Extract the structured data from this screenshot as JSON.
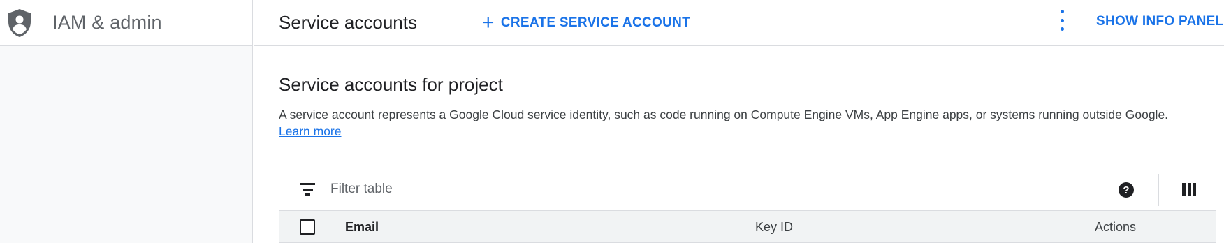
{
  "nav": {
    "title": "IAM & admin",
    "icon": "shield-person-icon"
  },
  "topbar": {
    "page_title": "Service accounts",
    "create_label": "CREATE SERVICE ACCOUNT",
    "create_icon": "+",
    "info_label": "SHOW INFO PANEL",
    "more_icon": "more-vert-icon"
  },
  "content": {
    "section_title": "Service accounts for project",
    "description": "A service account represents a Google Cloud service identity, such as code running on Compute Engine VMs, App Engine apps, or systems running outside Google.",
    "learn_more": "Learn more"
  },
  "table": {
    "filter_placeholder": "Filter table",
    "help_glyph": "?",
    "columns": [
      "Email",
      "Key ID",
      "Actions"
    ]
  },
  "colors": {
    "accent": "#1a73e8",
    "nav_bg": "#f8f9fa",
    "header_bg": "#f1f3f4",
    "border": "#dadce0"
  }
}
